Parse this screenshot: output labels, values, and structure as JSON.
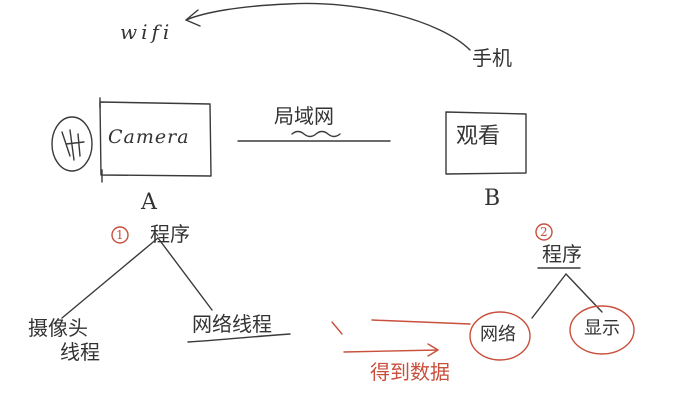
{
  "labels": {
    "wifi": "wifi",
    "phone": "手机",
    "lan": "局域网",
    "camera": "Camera",
    "watch": "观看",
    "node_a": "A",
    "node_b": "B",
    "step_1": "1",
    "step_2": "2",
    "program_a": "程序",
    "capture_line1": "摄像头",
    "capture_line2": "线程",
    "network_thread": "网络线程",
    "get_data": "得到数据",
    "program_b": "程序",
    "network_b": "网络",
    "display_b": "显示"
  },
  "colors": {
    "ink": "#3a3a3a",
    "annotation": "#c8503c",
    "background": "#ffffff"
  }
}
